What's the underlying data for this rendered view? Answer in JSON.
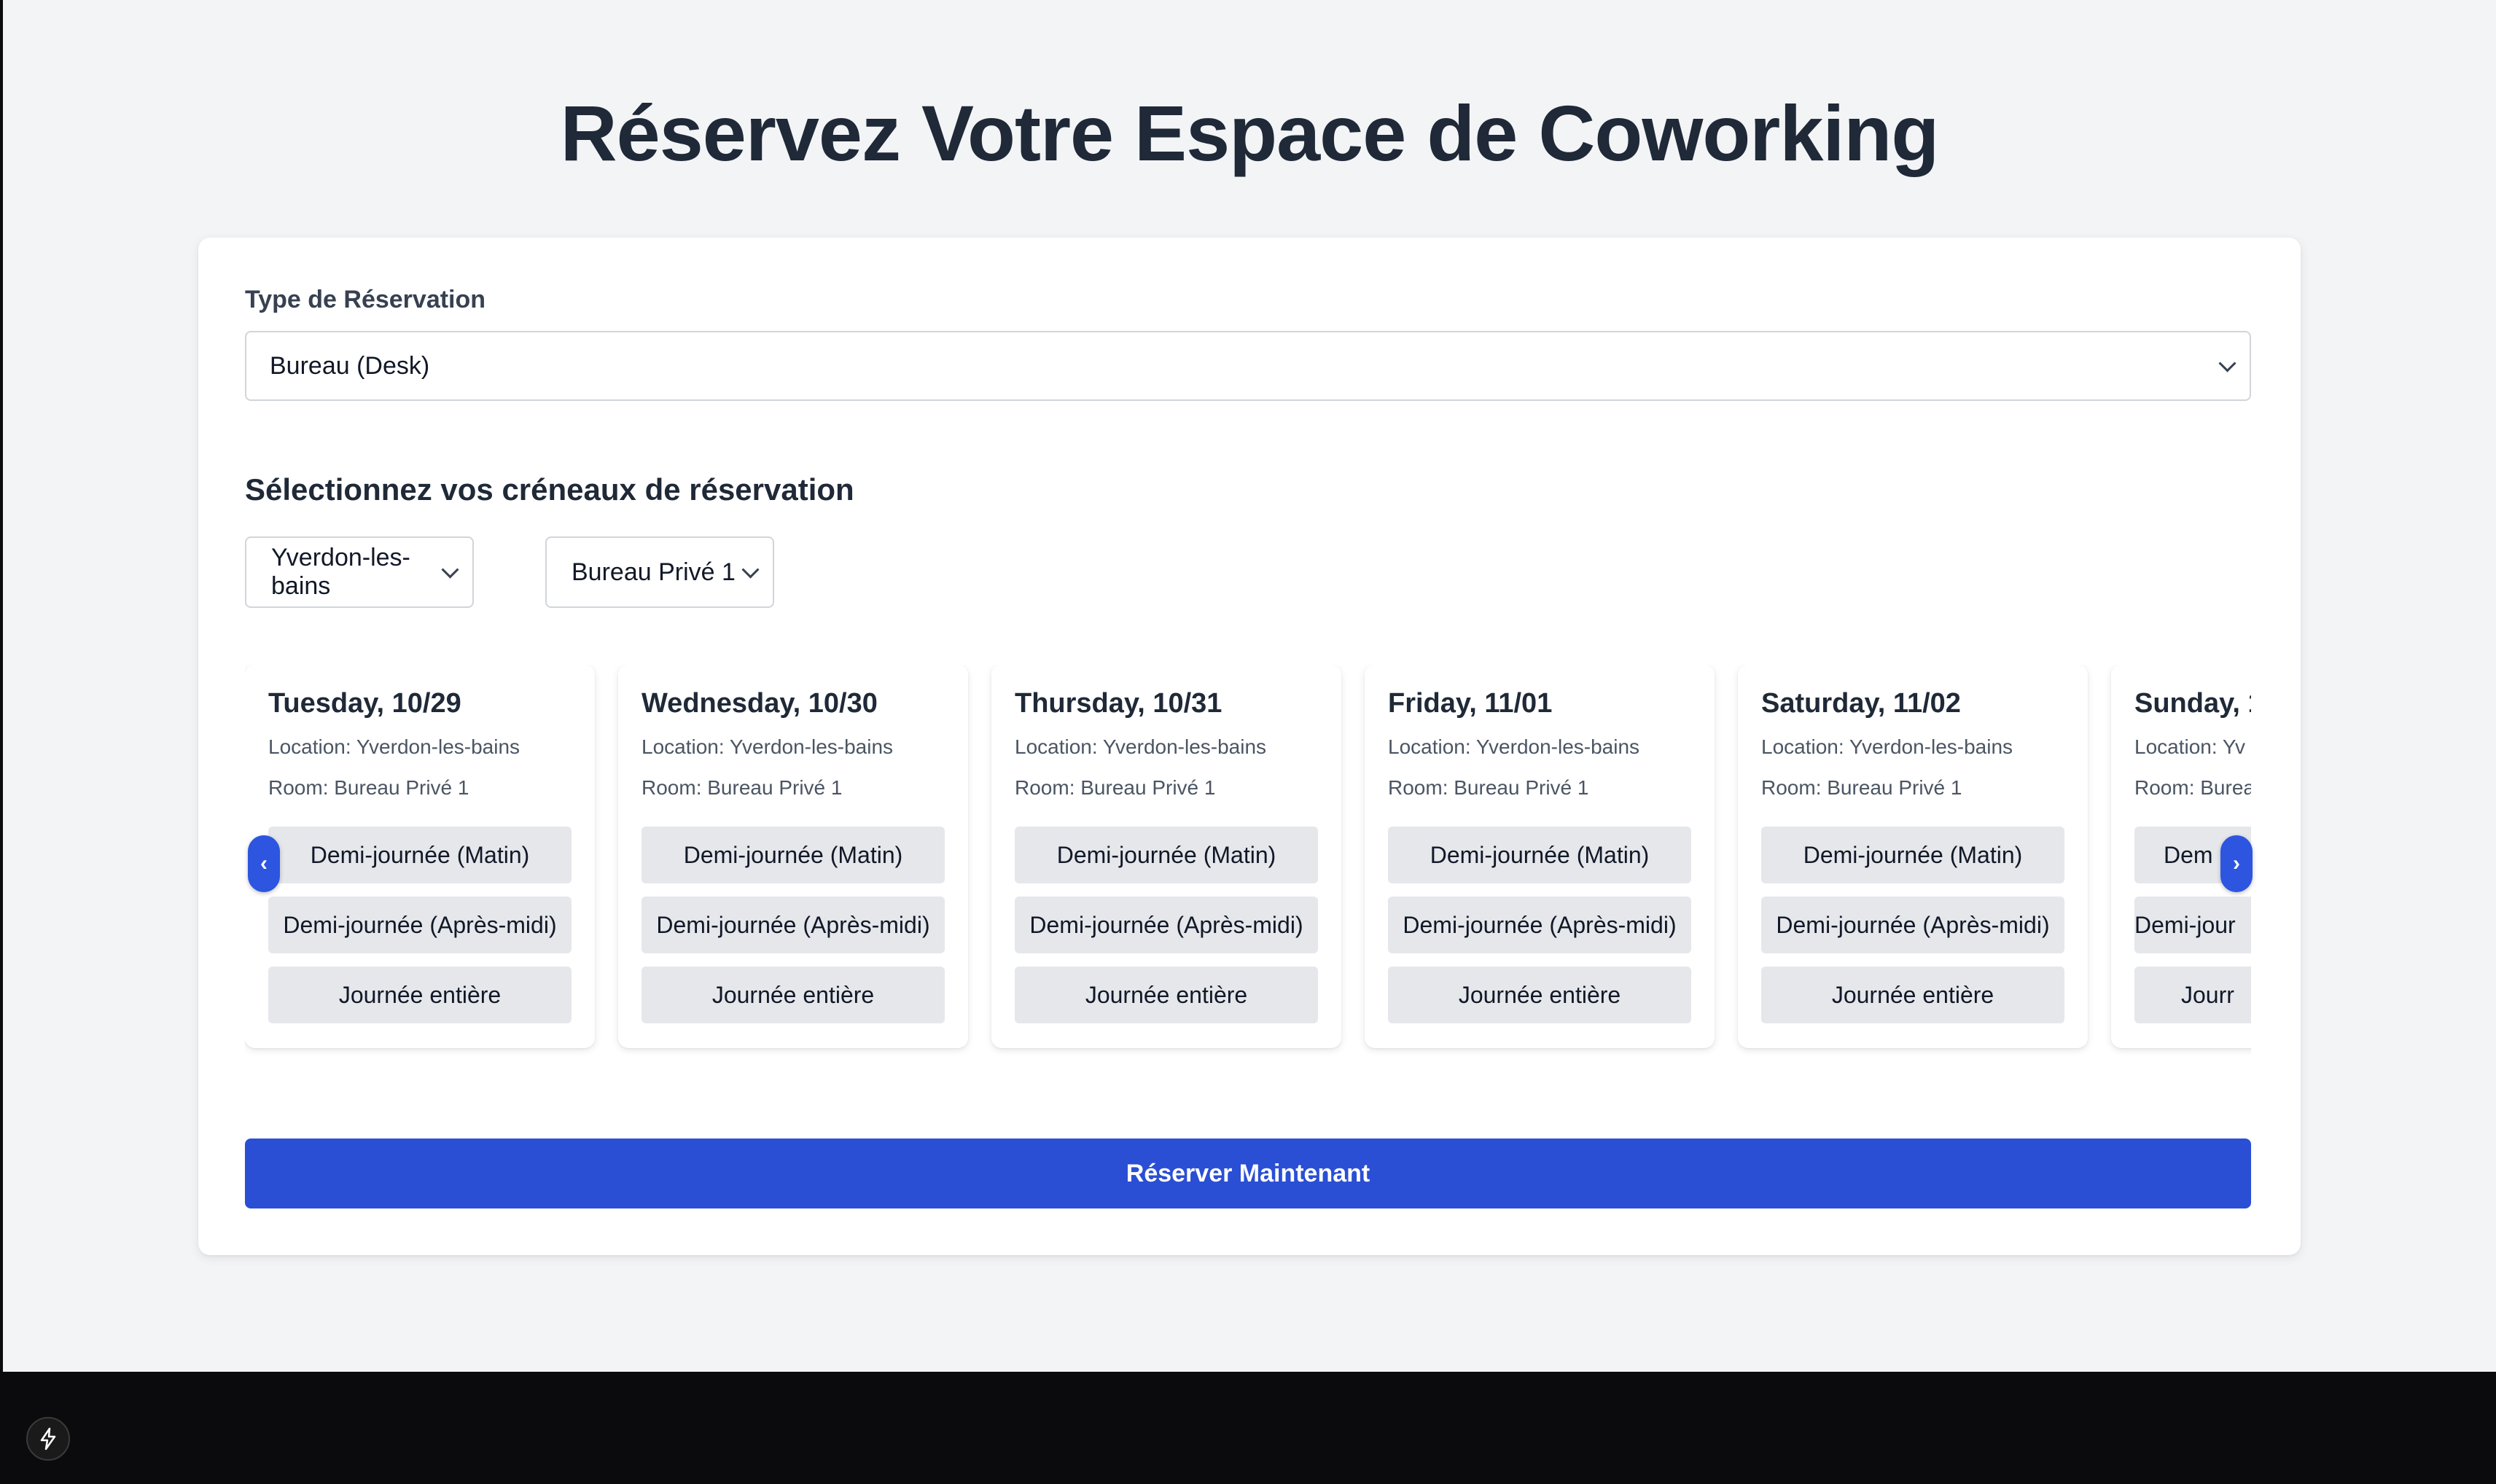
{
  "page": {
    "title": "Réservez Votre Espace de Coworking"
  },
  "form": {
    "type_label": "Type de Réservation",
    "type_value": "Bureau (Desk)",
    "section_title": "Sélectionnez vos créneaux de réservation",
    "location_value": "Yverdon-les-bains",
    "room_value": "Bureau Privé 1",
    "submit_label": "Réserver Maintenant"
  },
  "days": [
    {
      "title": "Tuesday, 10/29",
      "location": "Location: Yverdon-les-bains",
      "room": "Room: Bureau Privé 1",
      "slot_morning": "Demi-journée (Matin)",
      "slot_afternoon": "Demi-journée (Après-midi)",
      "slot_full": "Journée entière"
    },
    {
      "title": "Wednesday, 10/30",
      "location": "Location: Yverdon-les-bains",
      "room": "Room: Bureau Privé 1",
      "slot_morning": "Demi-journée (Matin)",
      "slot_afternoon": "Demi-journée (Après-midi)",
      "slot_full": "Journée entière"
    },
    {
      "title": "Thursday, 10/31",
      "location": "Location: Yverdon-les-bains",
      "room": "Room: Bureau Privé 1",
      "slot_morning": "Demi-journée (Matin)",
      "slot_afternoon": "Demi-journée (Après-midi)",
      "slot_full": "Journée entière"
    },
    {
      "title": "Friday, 11/01",
      "location": "Location: Yverdon-les-bains",
      "room": "Room: Bureau Privé 1",
      "slot_morning": "Demi-journée (Matin)",
      "slot_afternoon": "Demi-journée (Après-midi)",
      "slot_full": "Journée entière"
    },
    {
      "title": "Saturday, 11/02",
      "location": "Location: Yverdon-les-bains",
      "room": "Room: Bureau Privé 1",
      "slot_morning": "Demi-journée (Matin)",
      "slot_afternoon": "Demi-journée (Après-midi)",
      "slot_full": "Journée entière"
    },
    {
      "title": "Sunday, 1",
      "location": "Location: Yv",
      "room": "Room: Burea",
      "slot_morning": "Dem",
      "slot_afternoon": "Demi-jour",
      "slot_full": "Jourr"
    }
  ],
  "nav": {
    "prev_icon": "‹",
    "next_icon": "›"
  },
  "icons": {
    "prev": "chevron-left-icon",
    "next": "chevron-right-icon",
    "bolt": "lightning-bolt-icon"
  },
  "colors": {
    "accent": "#2a4fd4",
    "arrow": "#2d55e0",
    "slot_bg": "#e5e7eb",
    "page_bg": "#f3f4f6",
    "footer_bg": "#0b0b0d"
  }
}
